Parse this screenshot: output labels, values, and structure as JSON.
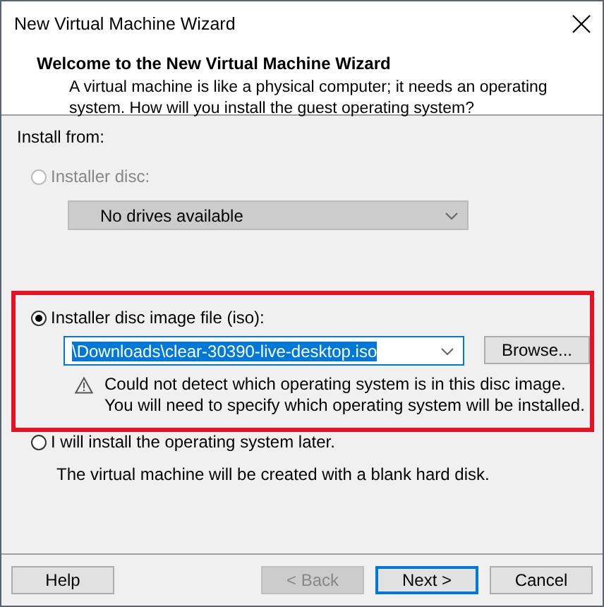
{
  "window": {
    "title": "New Virtual Machine Wizard"
  },
  "header": {
    "title": "Welcome to the New Virtual Machine Wizard",
    "description": "A virtual machine is like a physical computer; it needs an operating system. How will you install the guest operating system?"
  },
  "install_from": {
    "label": "Install from:",
    "options": [
      {
        "kind": "disc",
        "label": "Installer disc:",
        "selected": false,
        "disabled": true,
        "dropdown": {
          "value": "No drives available",
          "disabled": true
        }
      },
      {
        "kind": "iso",
        "label": "Installer disc image file (iso):",
        "selected": true,
        "disabled": false,
        "highlighted": true,
        "combo": {
          "value": "\\Downloads\\clear-30390-live-desktop.iso",
          "text_selected": true
        },
        "browse": "Browse...",
        "warning": [
          "Could not detect which operating system is in this disc image.",
          "You will need to specify which operating system will be installed."
        ]
      },
      {
        "kind": "later",
        "label": "I will install the operating system later.",
        "selected": false,
        "disabled": false,
        "description": "The virtual machine will be created with a blank hard disk."
      }
    ]
  },
  "buttons": [
    {
      "label": "Help",
      "disabled": false,
      "default": false
    },
    {
      "label": "< Back",
      "disabled": true,
      "default": false
    },
    {
      "label": "Next >",
      "disabled": false,
      "default": true
    },
    {
      "label": "Cancel",
      "disabled": false,
      "default": false
    }
  ]
}
